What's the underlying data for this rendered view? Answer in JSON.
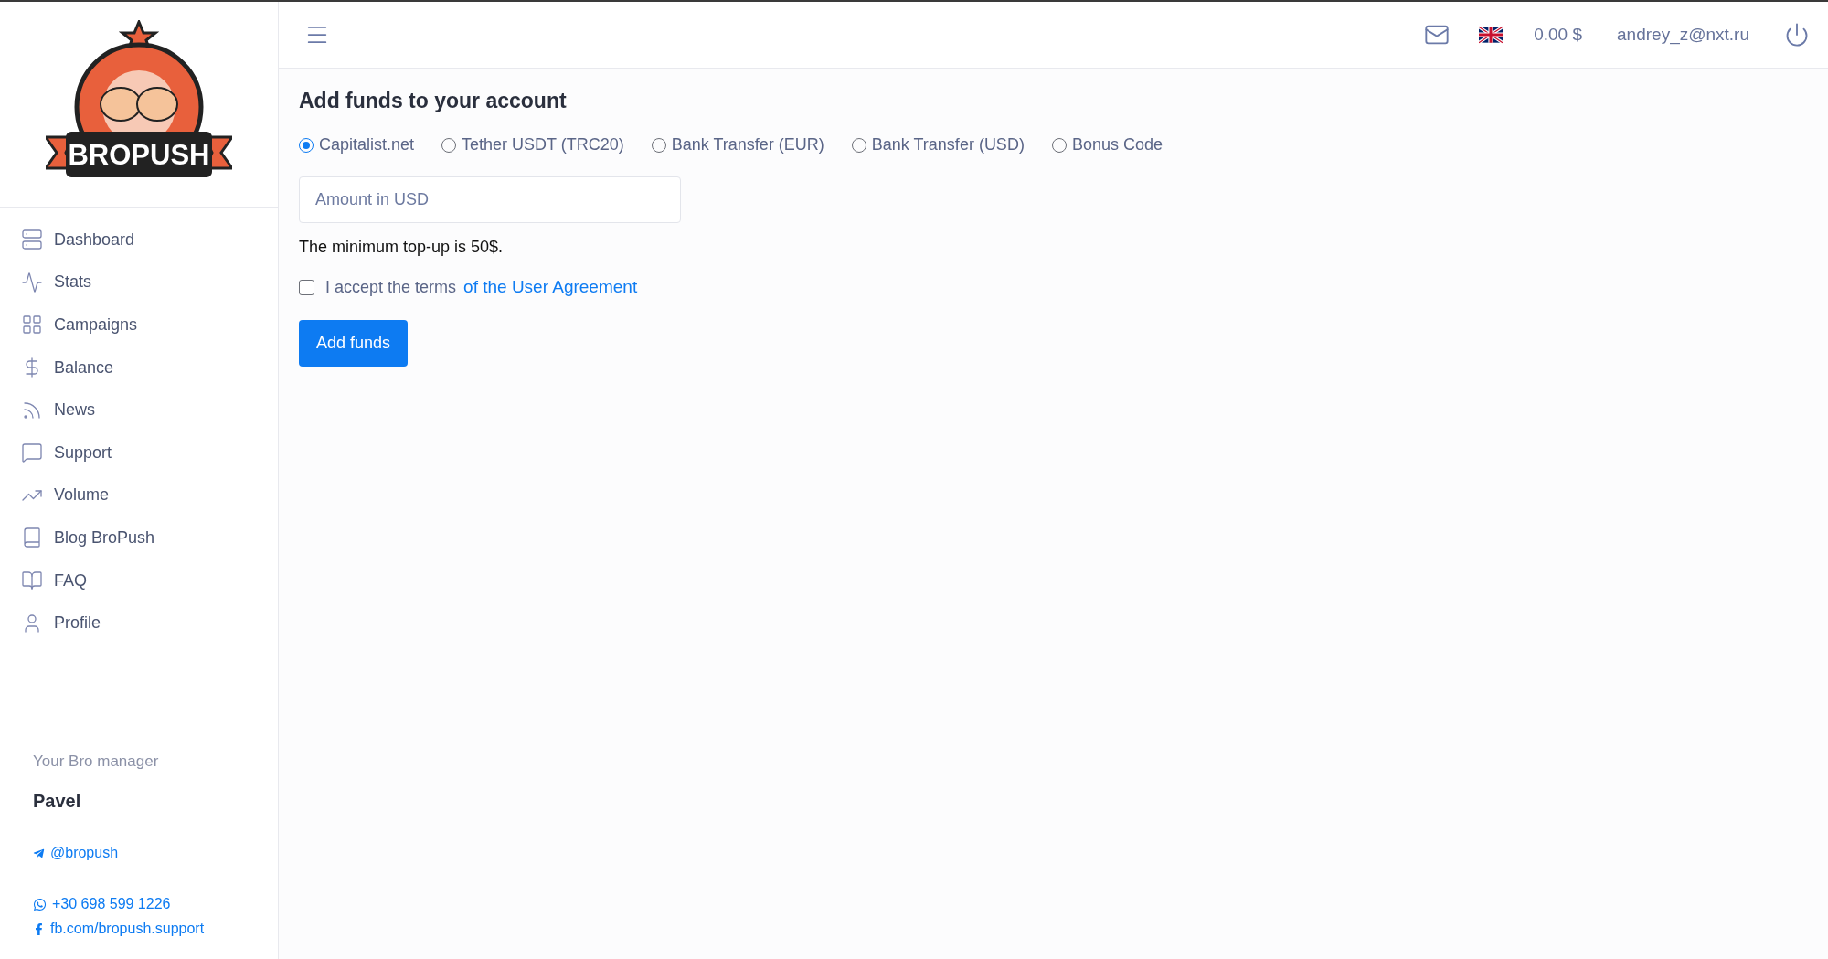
{
  "logo": {
    "text": "BROPUSH"
  },
  "sidebar": {
    "items": [
      {
        "label": "Dashboard",
        "selected": false
      },
      {
        "label": "Stats",
        "selected": false
      },
      {
        "label": "Campaigns",
        "selected": false
      },
      {
        "label": "Balance",
        "selected": false
      },
      {
        "label": "News",
        "selected": false
      },
      {
        "label": "Support",
        "selected": false
      },
      {
        "label": "Volume",
        "selected": false
      },
      {
        "label": "Blog BroPush",
        "selected": false
      },
      {
        "label": "FAQ",
        "selected": false
      },
      {
        "label": "Profile",
        "selected": false
      }
    ],
    "manager": {
      "heading": "Your Bro manager",
      "name": "Pavel",
      "telegram": "@bropush",
      "phone": "+30 698 599 1226",
      "facebook": "fb.com/bropush.support"
    }
  },
  "topbar": {
    "balance": "0.00 $",
    "user": "andrey_z@nxt.ru"
  },
  "page": {
    "title": "Add funds to your account",
    "methods": [
      {
        "label": "Capitalist.net",
        "selected": true
      },
      {
        "label": "Tether USDT (TRC20)",
        "selected": false
      },
      {
        "label": "Bank Transfer (EUR)",
        "selected": false
      },
      {
        "label": "Bank Transfer (USD)",
        "selected": false
      },
      {
        "label": "Bonus Code",
        "selected": false
      }
    ],
    "amount": {
      "placeholder": "Amount in USD"
    },
    "note": "The minimum top-up is 50$.",
    "terms": {
      "checked": false,
      "text": "I accept the terms",
      "link": "of the User Agreement"
    },
    "submit": "Add funds"
  }
}
